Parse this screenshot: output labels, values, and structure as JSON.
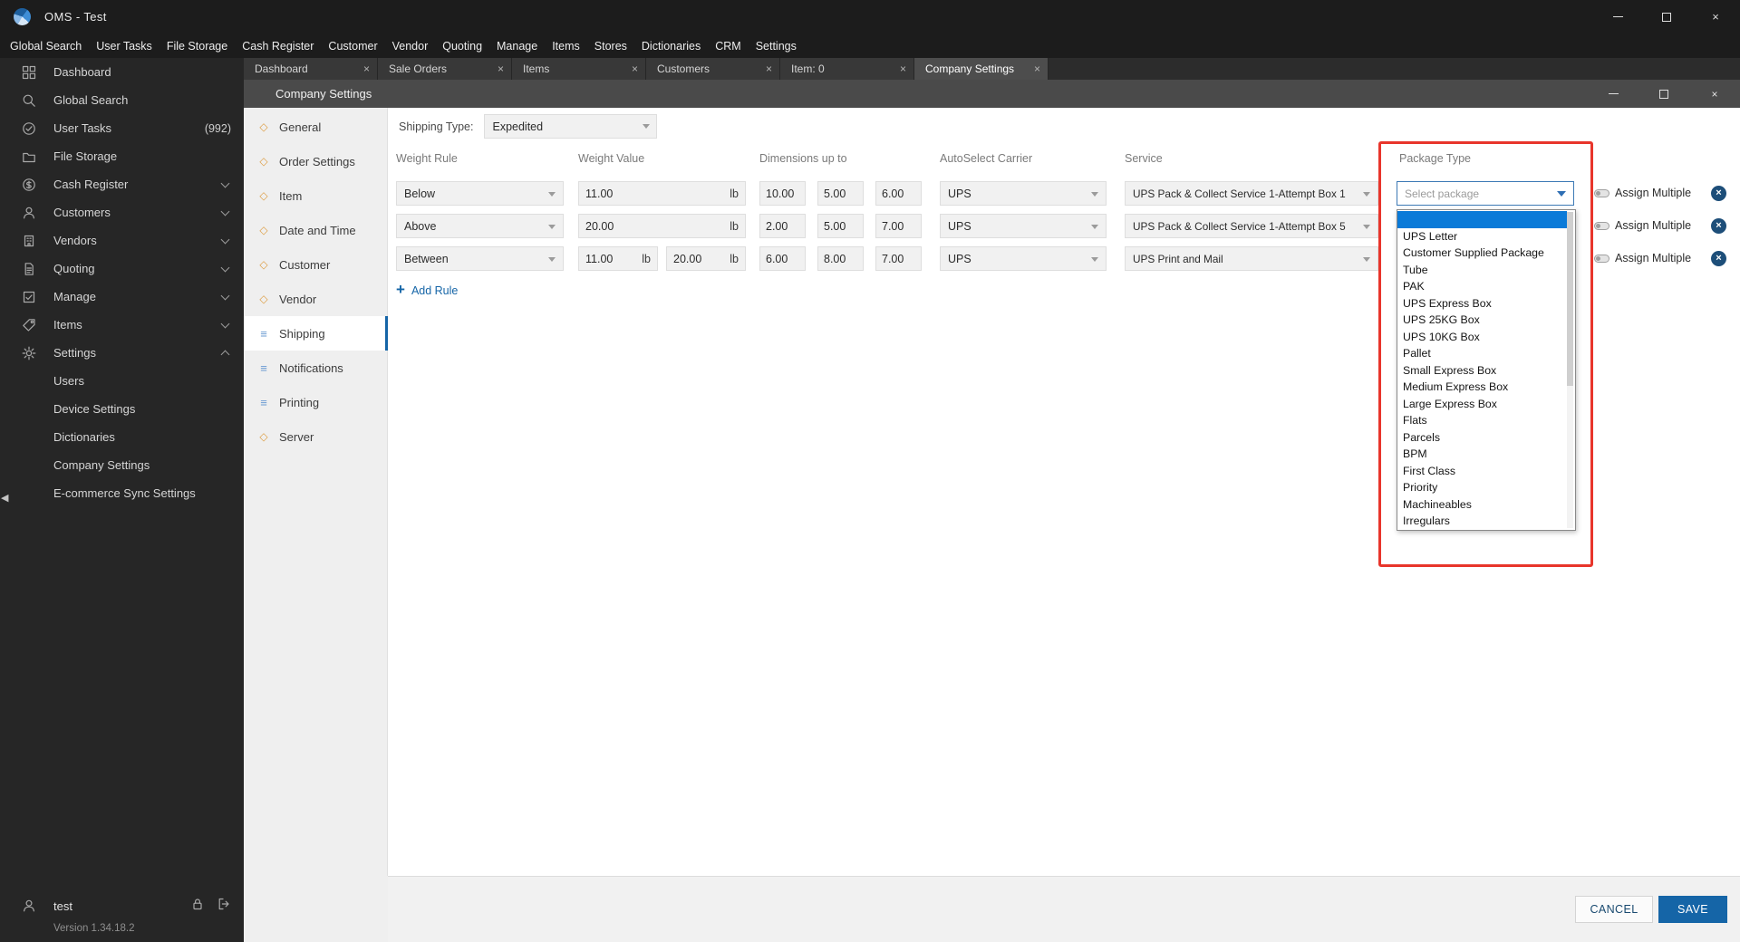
{
  "window": {
    "title": "OMS  -  Test",
    "user": "test",
    "version": "Version 1.34.18.2"
  },
  "menubar": {
    "items": [
      "Global Search",
      "User Tasks",
      "File Storage",
      "Cash Register",
      "Customer",
      "Vendor",
      "Quoting",
      "Manage",
      "Items",
      "Stores",
      "Dictionaries",
      "CRM",
      "Settings"
    ]
  },
  "sidebar": {
    "items": [
      {
        "label": "Dashboard",
        "icon": "dashboard"
      },
      {
        "label": "Global Search",
        "icon": "search"
      },
      {
        "label": "User Tasks",
        "icon": "tasks",
        "badge": "(992)"
      },
      {
        "label": "File Storage",
        "icon": "storage"
      },
      {
        "label": "Cash Register",
        "icon": "cash",
        "chevron": "down"
      },
      {
        "label": "Customers",
        "icon": "customers",
        "chevron": "down"
      },
      {
        "label": "Vendors",
        "icon": "vendors",
        "chevron": "down"
      },
      {
        "label": "Quoting",
        "icon": "quoting",
        "chevron": "down"
      },
      {
        "label": "Manage",
        "icon": "manage",
        "chevron": "down"
      },
      {
        "label": "Items",
        "icon": "items",
        "chevron": "down"
      },
      {
        "label": "Settings",
        "icon": "settings",
        "chevron": "up",
        "children": [
          "Users",
          "Device Settings",
          "Dictionaries",
          "Company Settings",
          "E-commerce Sync Settings"
        ]
      }
    ]
  },
  "tabs": {
    "items": [
      "Dashboard",
      "Sale Orders",
      "Items",
      "Customers",
      "Item: 0",
      "Company Settings"
    ],
    "active": "Company Settings"
  },
  "panel": {
    "title": "Company Settings",
    "selected": "Shipping",
    "nav": [
      {
        "label": "General",
        "icon": "diamond"
      },
      {
        "label": "Order Settings",
        "icon": "diamond"
      },
      {
        "label": "Item",
        "icon": "diamond"
      },
      {
        "label": "Date and Time",
        "icon": "diamond"
      },
      {
        "label": "Customer",
        "icon": "diamond"
      },
      {
        "label": "Vendor",
        "icon": "diamond"
      },
      {
        "label": "Shipping",
        "icon": "lines"
      },
      {
        "label": "Notifications",
        "icon": "lines"
      },
      {
        "label": "Printing",
        "icon": "lines"
      },
      {
        "label": "Server",
        "icon": "diamond"
      }
    ]
  },
  "shipping": {
    "type_label": "Shipping Type:",
    "type_value": "Expedited",
    "columns": [
      "Weight Rule",
      "Weight Value",
      "Dimensions up to",
      "AutoSelect Carrier",
      "Service",
      "Package Type"
    ],
    "rows": [
      {
        "rule": "Below",
        "weights": [
          {
            "value": "11.00",
            "unit": "lb"
          }
        ],
        "dims": [
          "10.00",
          "5.00",
          "6.00"
        ],
        "carrier": "UPS",
        "service": "UPS Pack & Collect Service 1-Attempt Box 1",
        "assign": "Assign Multiple"
      },
      {
        "rule": "Above",
        "weights": [
          {
            "value": "20.00",
            "unit": "lb"
          }
        ],
        "dims": [
          "2.00",
          "5.00",
          "7.00"
        ],
        "carrier": "UPS",
        "service": "UPS Pack & Collect Service 1-Attempt Box 5",
        "assign": "Assign Multiple"
      },
      {
        "rule": "Between",
        "weights": [
          {
            "value": "11.00",
            "unit": "lb"
          },
          {
            "value": "20.00",
            "unit": "lb"
          }
        ],
        "dims": [
          "6.00",
          "8.00",
          "7.00"
        ],
        "carrier": "UPS",
        "service": "UPS Print and Mail",
        "assign": "Assign Multiple"
      }
    ],
    "add_rule": "Add Rule",
    "package_dropdown": {
      "placeholder": "Select package",
      "options": [
        "",
        "UPS Letter",
        "Customer Supplied Package",
        "Tube",
        "PAK",
        "UPS Express Box",
        "UPS 25KG Box",
        "UPS 10KG Box",
        "Pallet",
        "Small Express Box",
        "Medium Express Box",
        "Large Express Box",
        "Flats",
        "Parcels",
        "BPM",
        "First Class",
        "Priority",
        "Machineables",
        "Irregulars"
      ]
    }
  },
  "footer": {
    "cancel": "CANCEL",
    "save": "SAVE"
  },
  "colors": {
    "accent": "#1565a7",
    "selection_blue": "#0a7ad8",
    "annotation_red": "#e8352b",
    "delete_blue": "#1d4e79"
  }
}
